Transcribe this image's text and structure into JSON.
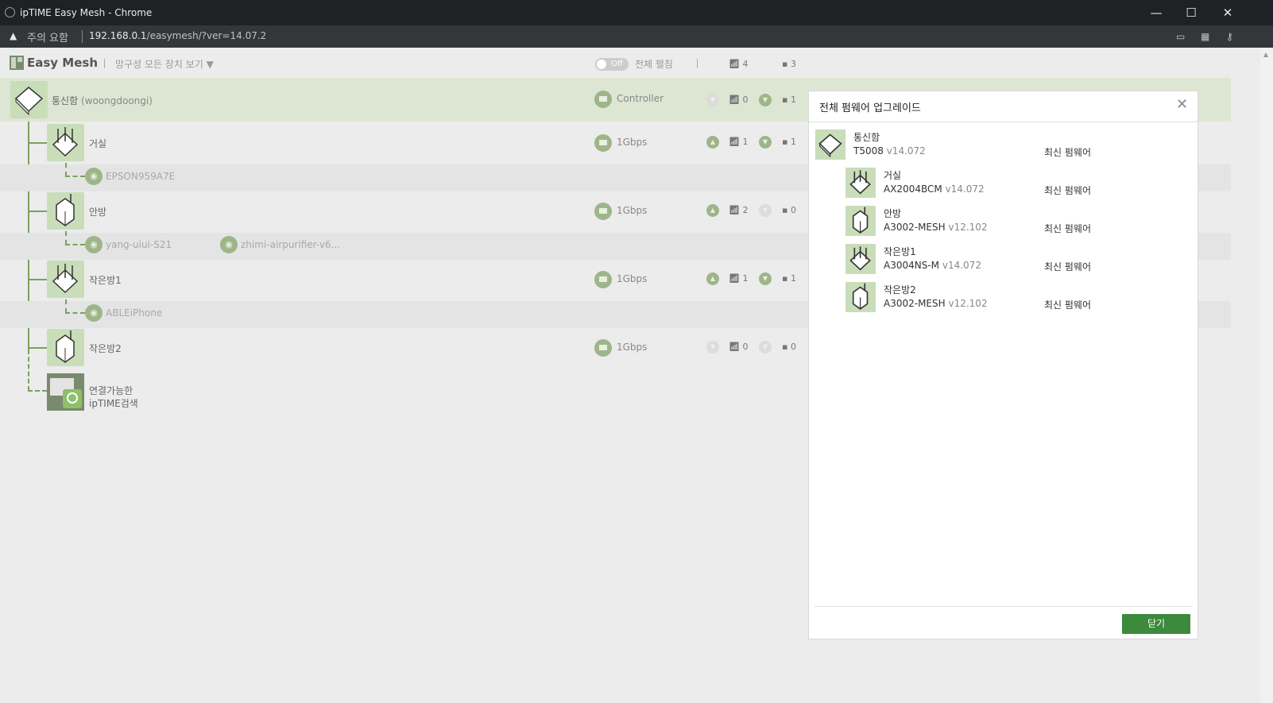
{
  "browser": {
    "title": "ipTIME Easy Mesh - Chrome",
    "warning_icon": "warning-triangle-icon",
    "warning_text": "주의 요함",
    "url_host": "192.168.0.1",
    "url_path": "/easymesh/?ver=14.07.2",
    "controls": {
      "minimize": "—",
      "maximize": "☐",
      "close": "✕"
    }
  },
  "appbar": {
    "logo_text": "Easy Mesh",
    "view_select": "망구성 모든 장치 보기 ▼",
    "toggle_state": "Off",
    "toggle_label": "전체 펼침",
    "wifi_count": "4",
    "lan_count": "3"
  },
  "tree": {
    "root": {
      "name": "통신함",
      "sub": "(woongdoongi)",
      "role": "Controller",
      "wifi": "0",
      "lan": "1"
    },
    "nodes": [
      {
        "name": "거실",
        "speed": "1Gbps",
        "wifi": "1",
        "lan": "1",
        "up_active": true,
        "down_active": true,
        "clients": [
          "EPSON959A7E"
        ]
      },
      {
        "name": "안방",
        "speed": "1Gbps",
        "wifi": "2",
        "lan": "0",
        "up_active": true,
        "down_active": false,
        "clients": [
          "yang-uiui-S21",
          "zhimi-airpurifier-v6..."
        ]
      },
      {
        "name": "작은방1",
        "speed": "1Gbps",
        "wifi": "1",
        "lan": "1",
        "up_active": true,
        "down_active": true,
        "clients": [
          "ABLEiPhone"
        ]
      },
      {
        "name": "작은방2",
        "speed": "1Gbps",
        "wifi": "0",
        "lan": "0",
        "up_active": false,
        "down_active": false,
        "clients": []
      }
    ],
    "search_label_1": "연결가능한",
    "search_label_2": "ipTIME검색"
  },
  "dialog": {
    "title": "전체 펌웨어 업그레이드",
    "close_btn": "닫기",
    "devices": [
      {
        "name": "통신함",
        "model": "T5008",
        "version": "v14.072",
        "status": "최신 펌웨어"
      },
      {
        "name": "거실",
        "model": "AX2004BCM",
        "version": "v14.072",
        "status": "최신 펌웨어"
      },
      {
        "name": "안방",
        "model": "A3002-MESH",
        "version": "v12.102",
        "status": "최신 펌웨어"
      },
      {
        "name": "작은방1",
        "model": "A3004NS-M",
        "version": "v14.072",
        "status": "최신 펌웨어"
      },
      {
        "name": "작은방2",
        "model": "A3002-MESH",
        "version": "v12.102",
        "status": "최신 펌웨어"
      }
    ]
  },
  "colors": {
    "accent_green": "#3d8a3d",
    "node_bg": "#c9ddb9",
    "root_row": "#dde6d3"
  }
}
